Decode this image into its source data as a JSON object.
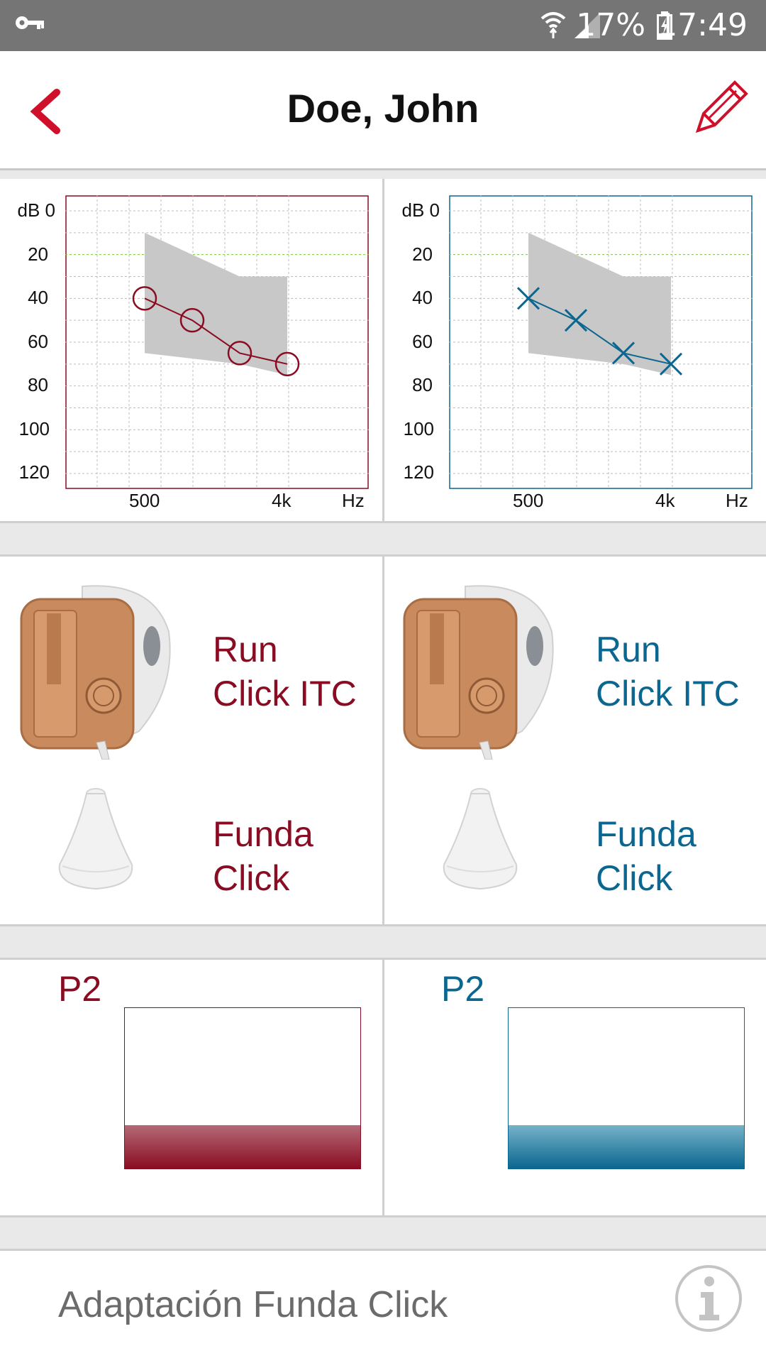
{
  "status_bar": {
    "battery": "17%",
    "time": "17:49"
  },
  "app_bar": {
    "title": "Doe, John"
  },
  "audiogram": {
    "y_unit": "dB",
    "y_ticks": [
      "0",
      "20",
      "40",
      "60",
      "80",
      "100",
      "120"
    ],
    "x_ticks": [
      "500",
      "4k"
    ],
    "x_unit": "Hz"
  },
  "chart_data": [
    {
      "type": "line",
      "name": "left-ear",
      "xlabel": "Hz",
      "ylabel": "dB",
      "ylim": [
        0,
        120
      ],
      "y_inverted": true,
      "x": [
        500,
        1000,
        2000,
        4000
      ],
      "y": [
        40,
        50,
        65,
        70
      ],
      "marker": "circle",
      "color": "#8a0c22",
      "fitting_range": {
        "low_hz": 500,
        "high_hz": 4000,
        "upper_db": [
          10,
          30,
          30
        ],
        "lower_db": [
          65,
          70,
          75
        ]
      }
    },
    {
      "type": "line",
      "name": "right-ear",
      "xlabel": "Hz",
      "ylabel": "dB",
      "ylim": [
        0,
        120
      ],
      "y_inverted": true,
      "x": [
        500,
        1000,
        2000,
        4000
      ],
      "y": [
        40,
        50,
        65,
        70
      ],
      "marker": "x",
      "color": "#0b6690",
      "fitting_range": {
        "low_hz": 500,
        "high_hz": 4000,
        "upper_db": [
          10,
          30,
          30
        ],
        "lower_db": [
          65,
          70,
          75
        ]
      }
    }
  ],
  "left": {
    "device_line1": "Run",
    "device_line2": "Click ITC",
    "dome_line1": "Funda",
    "dome_line2": "Click",
    "program": "P2",
    "level": 0.27
  },
  "right": {
    "device_line1": "Run",
    "device_line2": "Click ITC",
    "dome_line1": "Funda",
    "dome_line2": "Click",
    "program": "P2",
    "level": 0.27
  },
  "footer": {
    "label": "Adaptación Funda Click"
  },
  "colors": {
    "left": "#8a0c22",
    "right": "#0b6690",
    "accent": "#d0102a"
  }
}
